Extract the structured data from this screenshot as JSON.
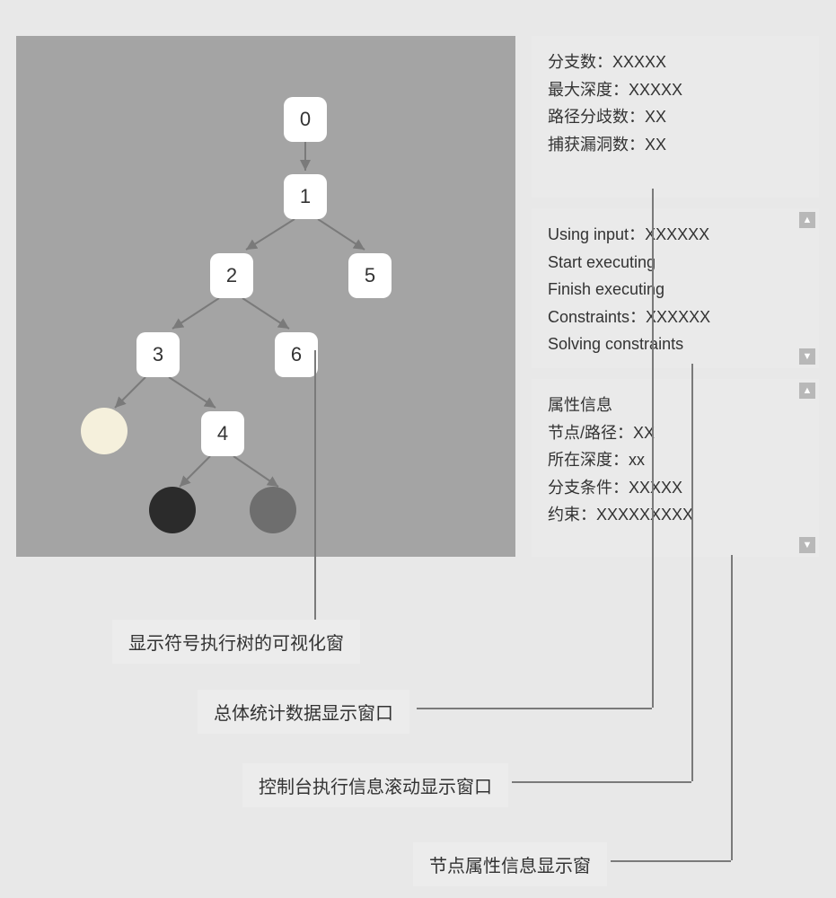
{
  "tree": {
    "nodes": {
      "n0": "0",
      "n1": "1",
      "n2": "2",
      "n3": "3",
      "n4": "4",
      "n5": "5",
      "n6": "6"
    }
  },
  "stats": {
    "branch_count_label": "分支数：",
    "branch_count_value": "XXXXX",
    "max_depth_label": "最大深度：",
    "max_depth_value": "XXXXX",
    "path_divergence_label": "路径分歧数：",
    "path_divergence_value": "XX",
    "caught_vulns_label": "捕获漏洞数：",
    "caught_vulns_value": "XX"
  },
  "console": {
    "l1_label": "Using input：",
    "l1_value": "XXXXXX",
    "l2": "Start executing",
    "l3": "Finish executing",
    "l4_label": "Constraints：",
    "l4_value": "XXXXXX",
    "l5": "Solving constraints"
  },
  "attrs": {
    "title": "属性信息",
    "node_path_label": "节点/路径：",
    "node_path_value": "XX",
    "depth_label": "所在深度：",
    "depth_value": "xx",
    "branch_cond_label": "分支条件：",
    "branch_cond_value": "XXXXX",
    "constraint_label": "约束：",
    "constraint_value": "XXXXXXXXX"
  },
  "callouts": {
    "c1": "显示符号执行树的可视化窗",
    "c2": "总体统计数据显示窗口",
    "c3": "控制台执行信息滚动显示窗口",
    "c4": "节点属性信息显示窗"
  },
  "chart_data": {
    "type": "diagram",
    "description": "Symbolic execution tree",
    "nodes": [
      {
        "id": 0,
        "label": "0",
        "kind": "square"
      },
      {
        "id": 1,
        "label": "1",
        "kind": "square"
      },
      {
        "id": 2,
        "label": "2",
        "kind": "square"
      },
      {
        "id": 5,
        "label": "5",
        "kind": "square"
      },
      {
        "id": 3,
        "label": "3",
        "kind": "square"
      },
      {
        "id": 6,
        "label": "6",
        "kind": "square"
      },
      {
        "id": 4,
        "label": "4",
        "kind": "square"
      },
      {
        "id": "L1",
        "label": "",
        "kind": "circle",
        "color": "light"
      },
      {
        "id": "L2",
        "label": "",
        "kind": "circle",
        "color": "dark"
      },
      {
        "id": "L3",
        "label": "",
        "kind": "circle",
        "color": "gray"
      }
    ],
    "edges": [
      [
        0,
        1
      ],
      [
        1,
        2
      ],
      [
        1,
        5
      ],
      [
        2,
        3
      ],
      [
        2,
        6
      ],
      [
        3,
        "L1"
      ],
      [
        3,
        4
      ],
      [
        4,
        "L2"
      ],
      [
        4,
        "L3"
      ]
    ]
  }
}
